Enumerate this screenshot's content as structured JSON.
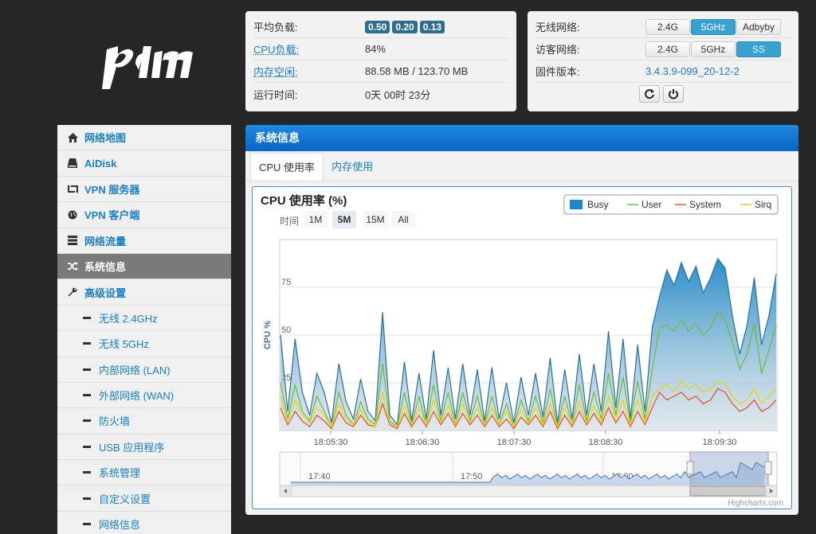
{
  "status": {
    "load_label": "平均负载:",
    "load_values": [
      "0.50",
      "0.20",
      "0.13"
    ],
    "cpu_label": "CPU负载:",
    "cpu_value": "84%",
    "mem_label": "内存空闲:",
    "mem_value": "88.58 MB / 123.70 MB",
    "uptime_label": "运行时间:",
    "uptime_value": "0天 00时 23分"
  },
  "wifi": {
    "wireless_label": "无线网络:",
    "wireless_buttons": [
      "2.4G",
      "5GHz",
      "Adbyby"
    ],
    "guest_label": "访客网络:",
    "guest_buttons": [
      "2.4G",
      "5GHz",
      "SS"
    ],
    "fw_label": "固件版本:",
    "fw_value": "3.4.3.9-099_20-12-2"
  },
  "sidebar": {
    "items": [
      {
        "label": "网络地图",
        "icon": "home-icon"
      },
      {
        "label": "AiDisk",
        "icon": "disk-icon"
      },
      {
        "label": "VPN 服务器",
        "icon": "retweet-icon"
      },
      {
        "label": "VPN 客户端",
        "icon": "globe-icon"
      },
      {
        "label": "网络流量",
        "icon": "server-icon"
      },
      {
        "label": "系统信息",
        "icon": "shuffle-icon"
      },
      {
        "label": "高级设置",
        "icon": "wrench-icon"
      }
    ],
    "subitems": [
      "无线 2.4GHz",
      "无线 5GHz",
      "内部网络 (LAN)",
      "外部网络 (WAN)",
      "防火墙",
      "USB 应用程序",
      "系统管理",
      "自定义设置",
      "网络信息"
    ]
  },
  "main": {
    "title": "系统信息",
    "tabs": [
      "CPU 使用率",
      "内存使用"
    ]
  },
  "colors": {
    "busy": "#1e88c7",
    "user": "#6cbf3f",
    "system": "#e8562a",
    "sirq": "#e6d21a",
    "header_blue": "#0a64c6"
  },
  "chart_data": {
    "type": "area",
    "title": "CPU 使用率 (%)",
    "ylabel": "CPU %",
    "ylim": [
      0,
      100
    ],
    "yticks": [
      "25",
      "50",
      "75"
    ],
    "xticks": [
      "18:05:30",
      "18:06:30",
      "18:07:30",
      "18:08:30",
      "18:09:30"
    ],
    "range_label": "时间",
    "range_buttons": [
      "1M",
      "5M",
      "15M",
      "All"
    ],
    "selected_range": "5M",
    "legend": [
      "Busy",
      "User",
      "System",
      "Sirq"
    ],
    "navigator_ticks": [
      "17:40",
      "17:50",
      "18:00"
    ],
    "credit": "Highcharts.com",
    "series": [
      {
        "name": "Busy",
        "values": [
          50,
          10,
          48,
          20,
          8,
          30,
          20,
          4,
          35,
          15,
          6,
          27,
          10,
          5,
          62,
          8,
          3,
          36,
          5,
          30,
          6,
          42,
          8,
          33,
          6,
          35,
          8,
          32,
          5,
          33,
          6,
          25,
          4,
          28,
          8,
          30,
          7,
          38,
          4,
          32,
          6,
          40,
          8,
          35,
          10,
          52,
          12,
          48,
          6,
          45,
          10,
          54,
          70,
          84,
          76,
          88,
          78,
          86,
          72,
          80,
          90,
          85,
          60,
          40,
          55,
          80,
          45,
          60,
          82
        ]
      },
      {
        "name": "User",
        "values": [
          25,
          6,
          24,
          10,
          5,
          18,
          10,
          2,
          20,
          8,
          3,
          15,
          6,
          3,
          35,
          5,
          2,
          20,
          3,
          18,
          3,
          24,
          5,
          20,
          3,
          20,
          5,
          18,
          3,
          18,
          3,
          14,
          2,
          16,
          5,
          18,
          4,
          22,
          2,
          18,
          3,
          24,
          5,
          20,
          6,
          30,
          8,
          28,
          4,
          26,
          6,
          32,
          54,
          55,
          52,
          58,
          52,
          56,
          50,
          54,
          62,
          58,
          46,
          32,
          40,
          56,
          30,
          42,
          55
        ]
      },
      {
        "name": "System",
        "values": [
          12,
          3,
          10,
          5,
          2,
          8,
          5,
          1,
          10,
          4,
          2,
          8,
          3,
          2,
          14,
          3,
          1,
          9,
          2,
          8,
          2,
          10,
          3,
          9,
          2,
          9,
          3,
          8,
          2,
          8,
          2,
          6,
          1,
          7,
          3,
          8,
          2,
          10,
          1,
          8,
          2,
          10,
          3,
          9,
          3,
          12,
          4,
          10,
          2,
          10,
          3,
          12,
          20,
          16,
          18,
          20,
          16,
          18,
          14,
          16,
          22,
          20,
          14,
          10,
          12,
          16,
          10,
          12,
          16
        ]
      },
      {
        "name": "Sirq",
        "values": [
          18,
          5,
          16,
          8,
          4,
          12,
          8,
          2,
          14,
          6,
          3,
          11,
          4,
          2,
          20,
          4,
          2,
          13,
          3,
          12,
          3,
          16,
          4,
          13,
          3,
          14,
          4,
          12,
          3,
          12,
          3,
          10,
          2,
          11,
          4,
          12,
          3,
          14,
          2,
          12,
          3,
          15,
          4,
          13,
          4,
          18,
          6,
          16,
          3,
          16,
          4,
          18,
          22,
          24,
          20,
          26,
          22,
          24,
          20,
          22,
          26,
          24,
          18,
          14,
          16,
          22,
          14,
          18,
          22
        ]
      }
    ]
  }
}
